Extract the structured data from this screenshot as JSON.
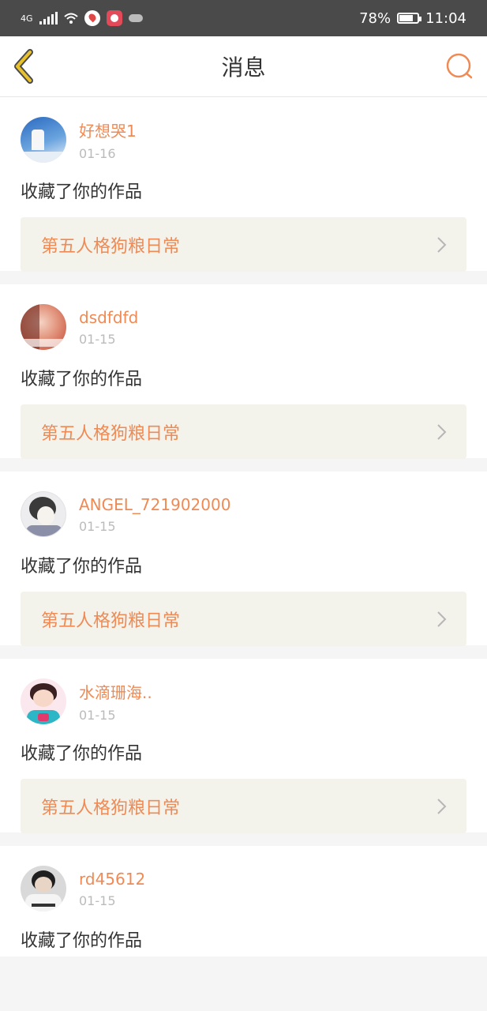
{
  "status": {
    "signal": "4G",
    "battery": "78%",
    "battery_level": 0.78,
    "time": "11:04"
  },
  "header": {
    "title": "消息",
    "back_icon": "chevron-left-icon",
    "search_icon": "search-icon"
  },
  "colors": {
    "accent": "#f08a54",
    "back_icon_stroke": "#e9c12c",
    "card_bg": "#f3f2eb"
  },
  "messages": [
    {
      "name": "好想哭1",
      "date": "01-16",
      "action": "收藏了你的作品",
      "work": "第五人格狗粮日常"
    },
    {
      "name": "dsdfdfd",
      "date": "01-15",
      "action": "收藏了你的作品",
      "work": "第五人格狗粮日常"
    },
    {
      "name": "ANGEL_721902000",
      "date": "01-15",
      "action": "收藏了你的作品",
      "work": "第五人格狗粮日常"
    },
    {
      "name": "水滴珊海..",
      "date": "01-15",
      "action": "收藏了你的作品",
      "work": "第五人格狗粮日常"
    },
    {
      "name": "rd45612",
      "date": "01-15",
      "action": "收藏了你的作品"
    }
  ]
}
